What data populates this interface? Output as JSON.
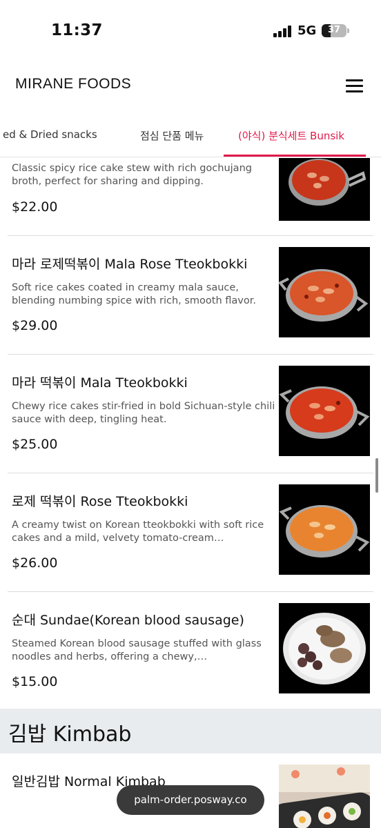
{
  "status_bar": {
    "time": "11:37",
    "network": "5G",
    "battery": "37",
    "battery_level": 0.37
  },
  "header": {
    "brand": "MIRANE FOODS",
    "menu_icon": "hamburger-icon"
  },
  "tabs": [
    {
      "label": "ed & Dried snacks",
      "active": false
    },
    {
      "label": "점심 단품 메뉴",
      "active": false
    },
    {
      "label": "(야식) 분식세트 Bunsik",
      "active": true
    }
  ],
  "items": [
    {
      "title": "",
      "desc": "Classic spicy rice cake stew with rich gochujang broth, perfect for sharing and dipping.",
      "price": "$22.00"
    },
    {
      "title": "마라 로제떡볶이 Mala Rose Tteokbokki",
      "desc": "Soft rice cakes coated in creamy mala sauce, blending numbing spice with rich, smooth flavor.",
      "price": "$29.00"
    },
    {
      "title": "마라 떡볶이 Mala Tteokbokki",
      "desc": "Chewy rice cakes stir-fried in bold Sichuan-style chili sauce with deep, tingling heat.",
      "price": "$25.00"
    },
    {
      "title": "로제 떡볶이 Rose Tteokbokki",
      "desc": "A creamy twist on Korean tteokbokki with soft rice cakes and a mild, velvety tomato-cream…",
      "price": "$26.00"
    },
    {
      "title": "순대 Sundae(Korean blood sausage)",
      "desc": "Steamed Korean blood sausage stuffed with glass noodles and herbs, offering a chewy,…",
      "price": "$15.00"
    }
  ],
  "section": {
    "title": "김밥 Kimbab"
  },
  "kimbab_items": [
    {
      "title": "일반김밥 Normal Kimbab"
    }
  ],
  "url_pill": "palm-order.posway.co",
  "colors": {
    "accent": "#e0194a",
    "section_bg": "#e8ecef",
    "pill_bg": "#3a3a3a"
  }
}
